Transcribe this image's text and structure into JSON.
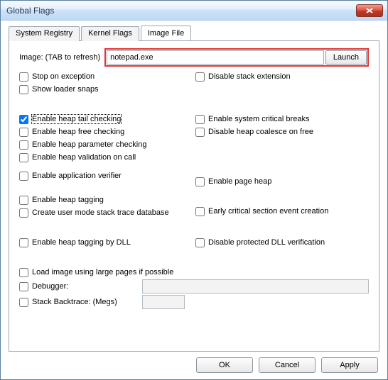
{
  "window": {
    "title": "Global Flags"
  },
  "tabs": {
    "t0": "System Registry",
    "t1": "Kernel Flags",
    "t2": "Image File"
  },
  "form": {
    "image_label": "Image: (TAB to refresh)",
    "image_value": "notepad.exe",
    "launch": "Launch",
    "stop_on_exception": "Stop on exception",
    "disable_stack_extension": "Disable stack extension",
    "show_loader_snaps": "Show loader snaps",
    "enable_heap_tail": "Enable heap tail checking",
    "enable_system_critical": "Enable system critical breaks",
    "enable_heap_free": "Enable heap free checking",
    "disable_heap_coalesce": "Disable heap coalesce on free",
    "enable_heap_param": "Enable heap parameter checking",
    "enable_heap_validation": "Enable heap validation on call",
    "enable_app_verifier": "Enable application verifier",
    "enable_page_heap": "Enable page heap",
    "enable_heap_tagging": "Enable heap tagging",
    "create_usermode_stack": "Create user mode stack trace database",
    "early_critical": "Early critical section event creation",
    "enable_heap_tagging_dll": "Enable heap tagging by DLL",
    "disable_protected_dll": "Disable protected DLL verification",
    "load_large_pages": "Load image using large pages if possible",
    "debugger": "Debugger:",
    "stack_backtrace": "Stack Backtrace: (Megs)"
  },
  "buttons": {
    "ok": "OK",
    "cancel": "Cancel",
    "apply": "Apply"
  }
}
